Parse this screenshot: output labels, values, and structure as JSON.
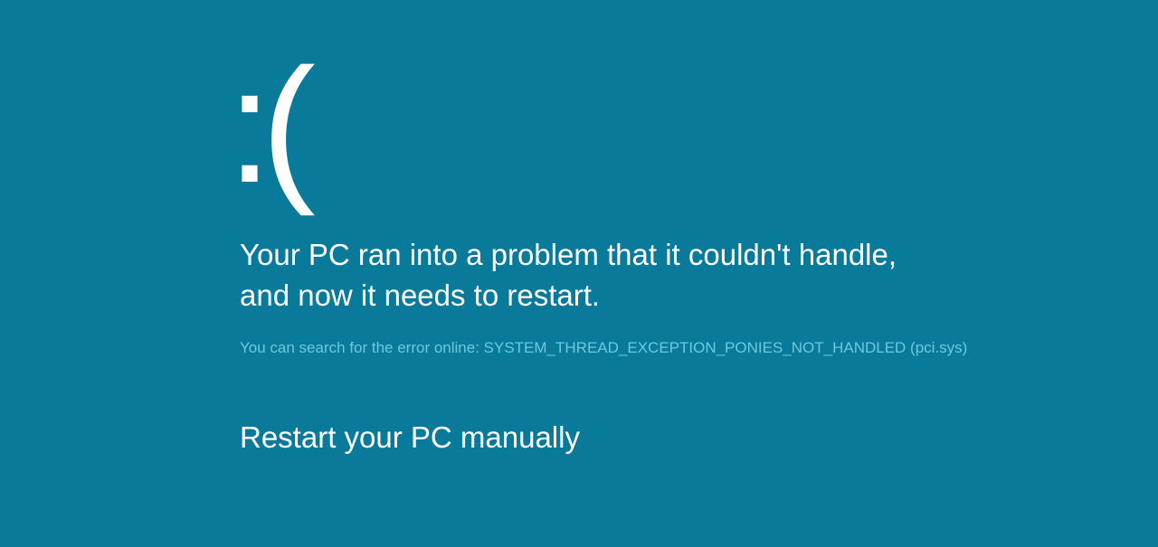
{
  "bsod": {
    "emoticon": ":(",
    "message": "Your PC ran into a problem that it couldn't handle, and now it needs to restart.",
    "error_prefix": "You can search for the error online: ",
    "error_code": "SYSTEM_THREAD_EXCEPTION_PONIES_NOT_HANDLED (pci.sys)",
    "instruction": "Restart your PC manually"
  }
}
